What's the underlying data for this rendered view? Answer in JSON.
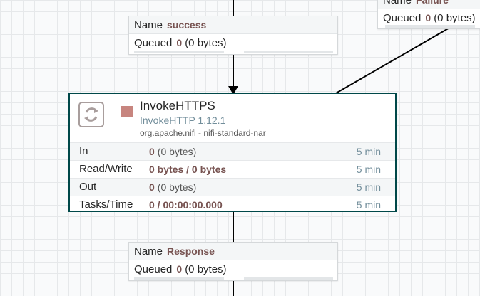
{
  "connections": {
    "top": {
      "name_label": "Name",
      "name": "success",
      "queued_label": "Queued",
      "queued_count": "0",
      "queued_size": "(0 bytes)"
    },
    "top_right": {
      "name_label": "Name",
      "name": "Failure",
      "queued_label": "Queued",
      "queued_count": "0",
      "queued_size": "(0 bytes)"
    },
    "bottom": {
      "name_label": "Name",
      "name": "Response",
      "queued_label": "Queued",
      "queued_count": "0",
      "queued_size": "(0 bytes)"
    }
  },
  "processor": {
    "name": "InvokeHTTPS",
    "type": "InvokeHTTP 1.12.1",
    "bundle": "org.apache.nifi - nifi-standard-nar",
    "status": "stopped",
    "status_color": "#c7857f",
    "stats": [
      {
        "label": "In",
        "value": "0",
        "detail": "(0 bytes)",
        "time": "5 min"
      },
      {
        "label": "Read/Write",
        "value": "0 bytes / 0 bytes",
        "detail": "",
        "time": "5 min"
      },
      {
        "label": "Out",
        "value": "0",
        "detail": "(0 bytes)",
        "time": "5 min"
      },
      {
        "label": "Tasks/Time",
        "value": "0 / 00:00:00.000",
        "detail": "",
        "time": "5 min"
      }
    ]
  },
  "colors": {
    "processor_border": "#004849",
    "value_text": "#775351",
    "type_text": "#728e9b"
  }
}
